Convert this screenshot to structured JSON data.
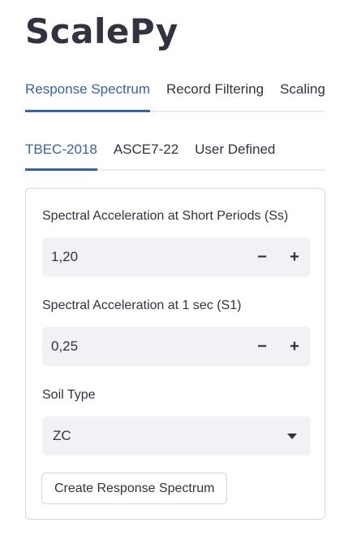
{
  "app": {
    "title": "ScalePy"
  },
  "main_tabs": [
    {
      "label": "Response Spectrum",
      "active": true
    },
    {
      "label": "Record Filtering",
      "active": false
    },
    {
      "label": "Scaling",
      "active": false
    }
  ],
  "sub_tabs": [
    {
      "label": "TBEC-2018",
      "active": true
    },
    {
      "label": "ASCE7-22",
      "active": false
    },
    {
      "label": "User Defined",
      "active": false
    }
  ],
  "form": {
    "ss": {
      "label": "Spectral Acceleration at Short Periods (Ss)",
      "value": "1,20",
      "minus": "−",
      "plus": "+"
    },
    "s1": {
      "label": "Spectral Acceleration at 1 sec (S1)",
      "value": "0,25",
      "minus": "−",
      "plus": "+"
    },
    "soil": {
      "label": "Soil Type",
      "value": "ZC"
    },
    "submit_label": "Create Response Spectrum"
  },
  "colors": {
    "accent": "#3a62a0",
    "input_bg": "#f0f2f6",
    "text": "#31333f",
    "border": "#d6d6d9"
  }
}
